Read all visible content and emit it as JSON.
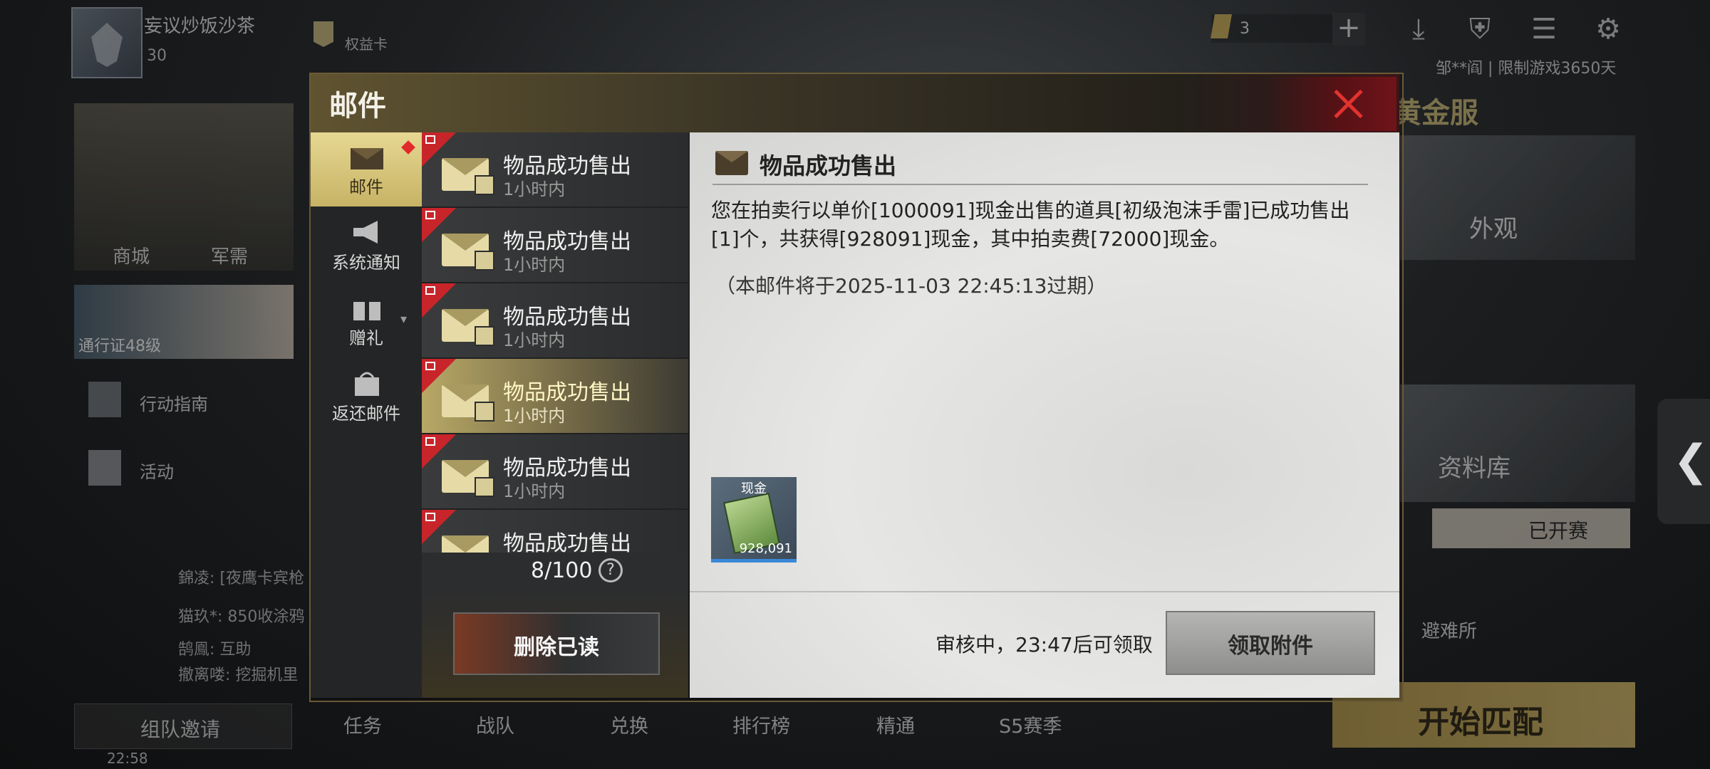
{
  "player": {
    "name": "妄议炒饭沙茶",
    "level": "30"
  },
  "top_bar": {
    "quanyi_card": "权益卡",
    "coin_count": "3",
    "limit_text": "邹**阎 | 限制游戏3650天"
  },
  "lobby": {
    "shop": "商城",
    "army": "军需",
    "pass": "通行证48级",
    "guide": "行动指南",
    "event": "活动",
    "gold_server": "黄金服",
    "appearance": "外观",
    "library": "资料库",
    "started": "已开赛",
    "refuge": "避难所",
    "start_match": "开始匹配",
    "team_invite": "组队邀请",
    "time": "22:58"
  },
  "chat_lines": [
    "錦凌: [夜鹰卡宾枪",
    "猫玖*: 850收涂鸦",
    "鹄鳯: 互助",
    "撤离喽: 挖掘机里"
  ],
  "bottom_nav": [
    "任务",
    "战队",
    "兑换",
    "排行榜",
    "精通",
    "S5赛季"
  ],
  "mail": {
    "title": "邮件",
    "categories": [
      {
        "label": "邮件",
        "icon": "envelope-icon"
      },
      {
        "label": "系统通知",
        "icon": "megaphone-icon"
      },
      {
        "label": "赠礼",
        "icon": "gift-icon"
      },
      {
        "label": "返还邮件",
        "icon": "bag-icon"
      }
    ],
    "items": [
      {
        "subject": "物品成功售出",
        "time": "1小时内"
      },
      {
        "subject": "物品成功售出",
        "time": "1小时内"
      },
      {
        "subject": "物品成功售出",
        "time": "1小时内"
      },
      {
        "subject": "物品成功售出",
        "time": "1小时内"
      },
      {
        "subject": "物品成功售出",
        "time": "1小时内"
      },
      {
        "subject": "物品成功售出",
        "time": ""
      }
    ],
    "selected_index": 3,
    "count": "8/100",
    "delete_read": "删除已读",
    "detail": {
      "title": "物品成功售出",
      "body": "您在拍卖行以单价[1000091]现金出售的道具[初级泡沫手雷]已成功售出[1]个，共获得[928091]现金，其中拍卖费[72000]现金。",
      "expire": "（本邮件将于2025-11-03 22:45:13过期）",
      "attachment": {
        "name": "现金",
        "qty": "928,091"
      },
      "review_status": "审核中，23:47后可领取",
      "claim_button": "领取附件"
    }
  },
  "colors": {
    "accent_gold": "#c7b365",
    "badge_red": "#e02a2a",
    "close_red": "#e3322f",
    "attachment_border": "#3a88d8"
  }
}
